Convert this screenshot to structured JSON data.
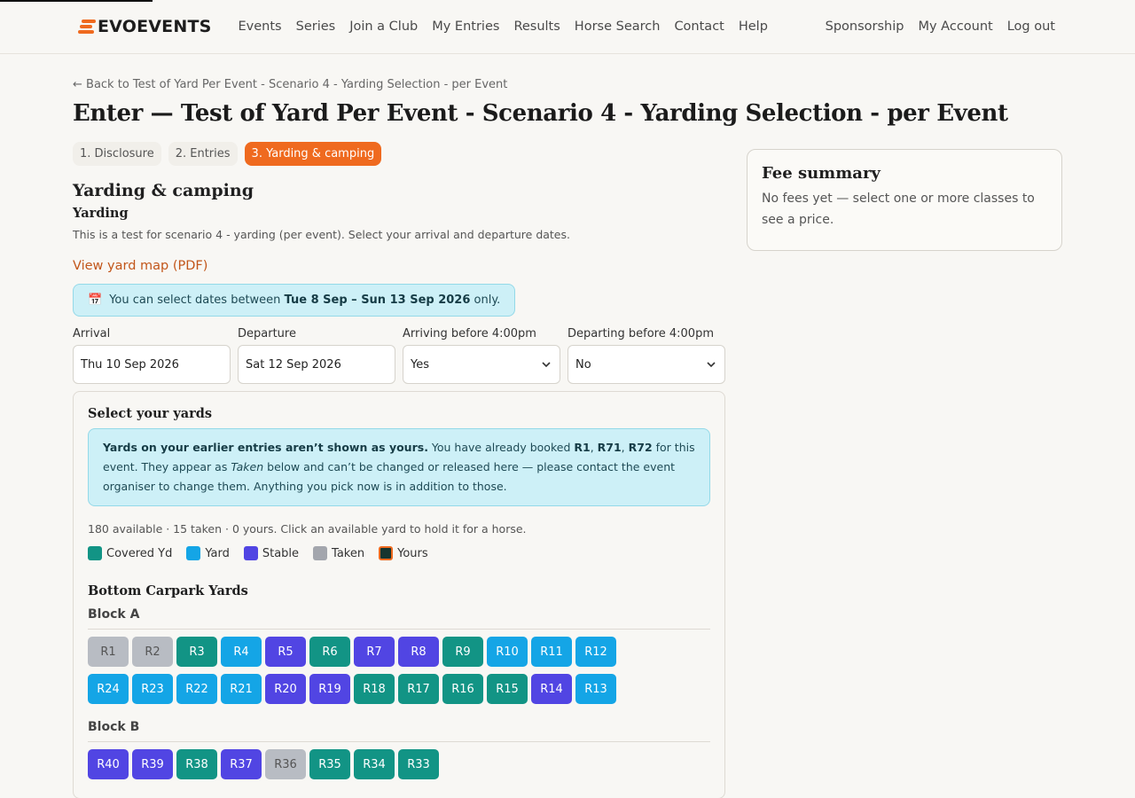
{
  "brand": {
    "name": "EVOEVENTS",
    "accent": "#ef6a1f"
  },
  "nav": {
    "links": [
      "Events",
      "Series",
      "Join a Club",
      "My Entries",
      "Results",
      "Horse Search",
      "Contact",
      "Help"
    ],
    "right": [
      "Sponsorship",
      "My Account",
      "Log out"
    ]
  },
  "page": {
    "back": "← Back to Test of Yard Per Event - Scenario 4 - Yarding Selection - per Event",
    "title": "Enter — Test of Yard Per Event - Scenario 4 - Yarding Selection - per Event",
    "steps": [
      "1. Disclosure",
      "2. Entries",
      "3. Yarding & camping"
    ],
    "section_title": "Yarding & camping",
    "sub_title": "Yarding",
    "description": "This is a test for scenario 4 - yarding (per event). Select your arrival and departure dates.",
    "map_link": "View yard map (PDF)",
    "date_note": {
      "icon": "calendar-icon",
      "prefix": "You can select dates between ",
      "range": "Tue 8 Sep – Sun 13 Sep 2026",
      "suffix": " only."
    }
  },
  "fields": {
    "arrival": {
      "label": "Arrival",
      "value": "Thu 10 Sep 2026"
    },
    "departure": {
      "label": "Departure",
      "value": "Sat 12 Sep 2026"
    },
    "arriving_before": {
      "label": "Arriving before 4:00pm",
      "value": "Yes"
    },
    "departing_before": {
      "label": "Departing before 4:00pm",
      "value": "No"
    }
  },
  "yards": {
    "title": "Select your yards",
    "warning": {
      "bold": "Yards on your earlier entries aren’t shown as yours.",
      "t1": " You have already booked ",
      "y1": "R1",
      "c1": ", ",
      "y2": "R71",
      "c2": ", ",
      "y3": "R72",
      "t2": " for this event. They appear as ",
      "taken_word": "Taken",
      "t3": " below and can’t be changed or released here — please contact the event organiser to change them. Anything you pick now is in addition to those."
    },
    "counts": "180 available · 15 taken · 0 yours. Click an available yard to hold it for a horse.",
    "legend": [
      {
        "label": "Covered Yd",
        "color": "#129485"
      },
      {
        "label": "Yard",
        "color": "#14a5e6"
      },
      {
        "label": "Stable",
        "color": "#5145e3"
      },
      {
        "label": "Taken",
        "color": "#a3a6ad"
      },
      {
        "label": "Yours",
        "color": "#16352f"
      }
    ],
    "section": "Bottom Carpark Yards",
    "blocks": [
      {
        "name": "Block A",
        "rows": [
          [
            [
              "R1",
              "taken"
            ],
            [
              "R2",
              "taken"
            ],
            [
              "R3",
              "covered"
            ],
            [
              "R4",
              "yard"
            ],
            [
              "R5",
              "stable"
            ],
            [
              "R6",
              "covered"
            ],
            [
              "R7",
              "stable"
            ],
            [
              "R8",
              "stable"
            ],
            [
              "R9",
              "covered"
            ],
            [
              "R10",
              "yard"
            ],
            [
              "R11",
              "yard"
            ],
            [
              "R12",
              "yard"
            ]
          ],
          [
            [
              "R24",
              "yard"
            ],
            [
              "R23",
              "yard"
            ],
            [
              "R22",
              "yard"
            ],
            [
              "R21",
              "yard"
            ],
            [
              "R20",
              "stable"
            ],
            [
              "R19",
              "stable"
            ],
            [
              "R18",
              "covered"
            ],
            [
              "R17",
              "covered"
            ],
            [
              "R16",
              "covered"
            ],
            [
              "R15",
              "covered"
            ],
            [
              "R14",
              "stable"
            ],
            [
              "R13",
              "yard"
            ]
          ]
        ]
      },
      {
        "name": "Block B",
        "rows": [
          [
            [
              "R40",
              "stable"
            ],
            [
              "R39",
              "stable"
            ],
            [
              "R38",
              "covered"
            ],
            [
              "R37",
              "stable"
            ],
            [
              "R36",
              "taken"
            ],
            [
              "R35",
              "covered"
            ],
            [
              "R34",
              "covered"
            ],
            [
              "R33",
              "covered"
            ]
          ]
        ]
      }
    ]
  },
  "fee": {
    "title": "Fee summary",
    "text": "No fees yet — select one or more classes to see a price."
  }
}
